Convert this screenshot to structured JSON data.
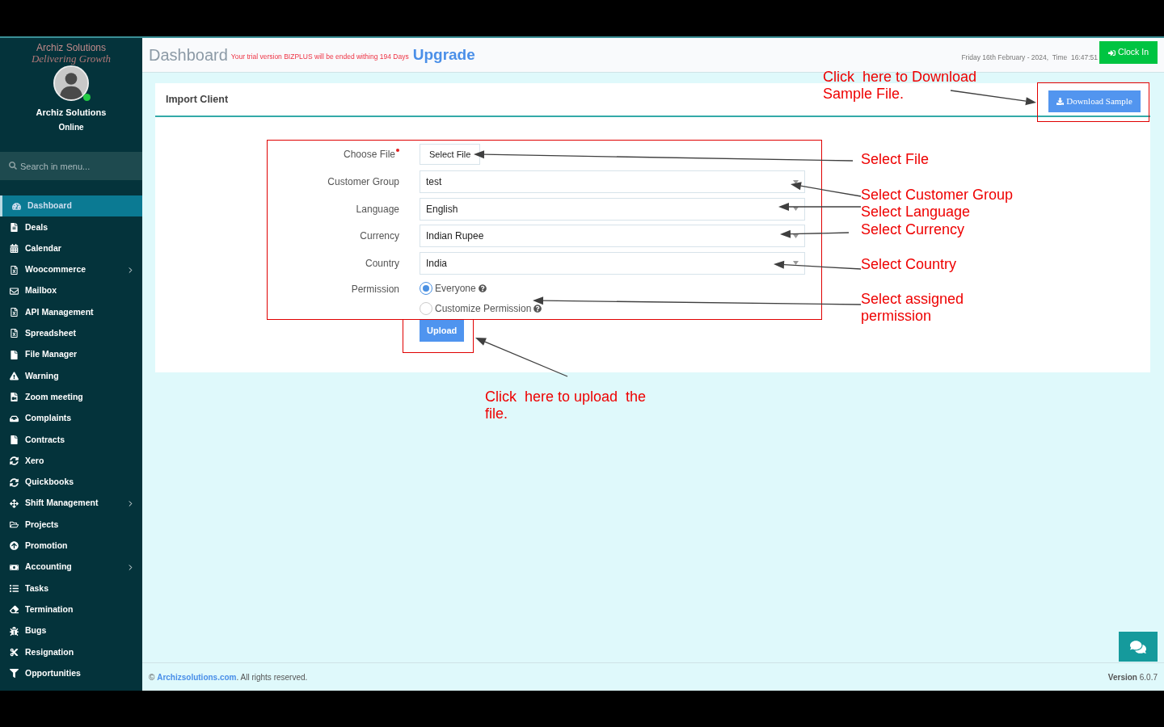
{
  "sidebar": {
    "logo": {
      "name": "Archiz Solutions",
      "tagline": "Delivering Growth"
    },
    "user": {
      "name": "Archiz Solutions",
      "status": "Online",
      "online": true
    },
    "search": {
      "placeholder": "Search in menu..."
    },
    "items": [
      {
        "label": "Dashboard",
        "selected": true,
        "has_submenu": false
      },
      {
        "label": "Deals",
        "selected": false,
        "has_submenu": false
      },
      {
        "label": "Calendar",
        "selected": false,
        "has_submenu": false
      },
      {
        "label": "Woocommerce",
        "selected": false,
        "has_submenu": true
      },
      {
        "label": "Mailbox",
        "selected": false,
        "has_submenu": false
      },
      {
        "label": "API Management",
        "selected": false,
        "has_submenu": false
      },
      {
        "label": "Spreadsheet",
        "selected": false,
        "has_submenu": false
      },
      {
        "label": "File Manager",
        "selected": false,
        "has_submenu": false
      },
      {
        "label": "Warning",
        "selected": false,
        "has_submenu": false
      },
      {
        "label": "Zoom meeting",
        "selected": false,
        "has_submenu": false
      },
      {
        "label": "Complaints",
        "selected": false,
        "has_submenu": false
      },
      {
        "label": "Contracts",
        "selected": false,
        "has_submenu": false
      },
      {
        "label": "Xero",
        "selected": false,
        "has_submenu": false
      },
      {
        "label": "Quickbooks",
        "selected": false,
        "has_submenu": false
      },
      {
        "label": "Shift Management",
        "selected": false,
        "has_submenu": true
      },
      {
        "label": "Projects",
        "selected": false,
        "has_submenu": false
      },
      {
        "label": "Promotion",
        "selected": false,
        "has_submenu": false
      },
      {
        "label": "Accounting",
        "selected": false,
        "has_submenu": true
      },
      {
        "label": "Tasks",
        "selected": false,
        "has_submenu": false
      },
      {
        "label": "Termination",
        "selected": false,
        "has_submenu": false
      },
      {
        "label": "Bugs",
        "selected": false,
        "has_submenu": false
      },
      {
        "label": "Resignation",
        "selected": false,
        "has_submenu": false
      },
      {
        "label": "Opportunities",
        "selected": false,
        "has_submenu": false
      }
    ]
  },
  "header": {
    "title": "Dashboard",
    "trial_notice": "Your trial version BIZPLUS will be ended withing 194 Days",
    "upgrade_link": "Upgrade",
    "datetime": "Friday 16th February - 2024,  Time  16:47:51",
    "clock_in_button": "Clock In"
  },
  "card": {
    "title": "Import Client",
    "download_button": "Download Sample",
    "fields": [
      {
        "kind": "file",
        "label": "Choose File",
        "required": true,
        "value": "Select File"
      },
      {
        "kind": "select",
        "label": "Customer Group",
        "required": false,
        "value": "test"
      },
      {
        "kind": "select",
        "label": "Language",
        "required": false,
        "value": "English"
      },
      {
        "kind": "select",
        "label": "Currency",
        "required": false,
        "value": "Indian Rupee"
      },
      {
        "kind": "select",
        "label": "Country",
        "required": false,
        "value": "India"
      },
      {
        "kind": "radio",
        "label": "Permission",
        "required": false,
        "options": [
          {
            "label": "Everyone",
            "selected": true
          },
          {
            "label": "Customize Permission",
            "selected": false
          }
        ]
      }
    ],
    "submit_button": "Upload"
  },
  "footer": {
    "copyright_symbol": "©",
    "link": "Archizsolutions.com",
    "copyright_suffix": ". All rights reserved.",
    "version_label": "Version",
    "version": "6.0.7"
  },
  "annotations": [
    "Click  here to Download\nSample File.",
    "Select File",
    "Select Customer Group",
    "Select Language",
    "Select Currency",
    "Select Country",
    "Select assigned\npermission",
    "Click  here to upload  the\nfile."
  ]
}
